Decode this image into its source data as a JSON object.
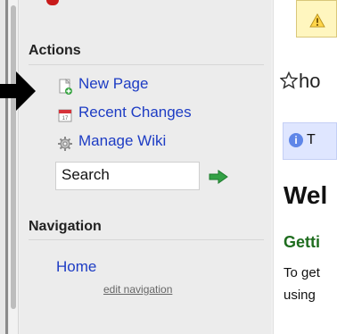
{
  "sidebar": {
    "actions_title": "Actions",
    "actions": [
      {
        "label": "New Page",
        "icon": "new-page-icon"
      },
      {
        "label": "Recent Changes",
        "icon": "calendar-icon"
      },
      {
        "label": "Manage Wiki",
        "icon": "gear-icon"
      }
    ],
    "search": {
      "value": "Search"
    },
    "navigation_title": "Navigation",
    "nav_home": "Home",
    "edit_navigation": "edit navigation"
  },
  "main": {
    "page_title_partial": "ho",
    "info_partial": "T",
    "welcome_partial": "Wel",
    "getting_partial": "Getti",
    "paragraph_line1_partial": "To get",
    "paragraph_line2_partial": "using"
  },
  "colors": {
    "link": "#1d3cc4",
    "section_green": "#1f6d1f",
    "info_bg": "#dfe6ff",
    "warn_bg": "#fff6bf"
  }
}
